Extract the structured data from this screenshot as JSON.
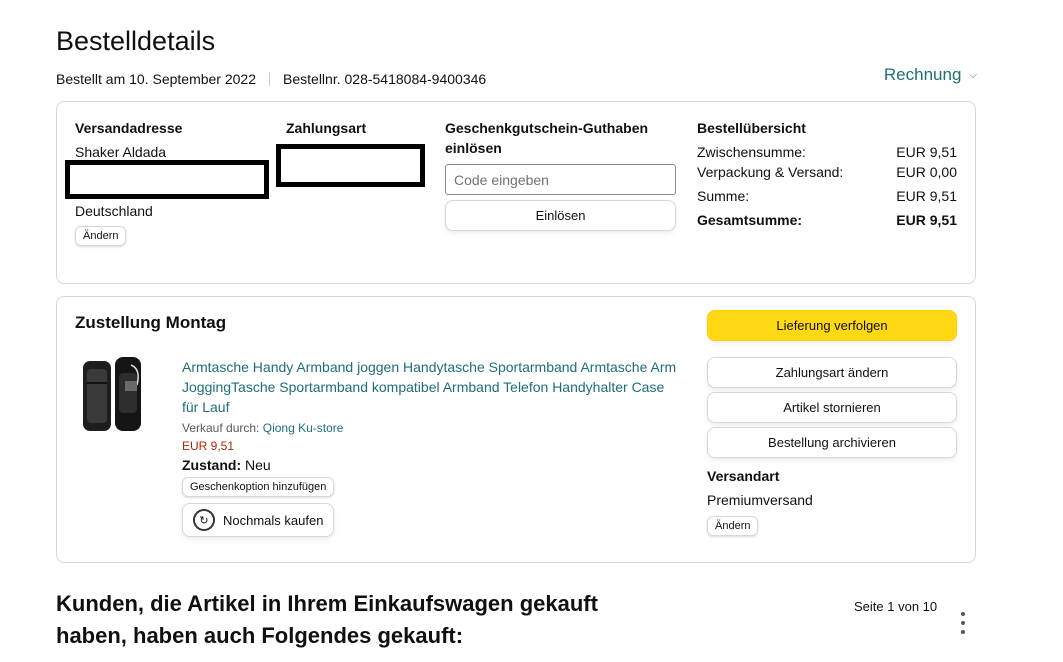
{
  "header": {
    "title": "Bestelldetails",
    "ordered_on": "Bestellt am 10. September 2022",
    "order_number": "Bestellnr. 028-5418084-9400346",
    "invoice_label": "Rechnung"
  },
  "address": {
    "title": "Versandadresse",
    "name": "Shaker Aldada",
    "country": "Deutschland",
    "change_label": "Ändern"
  },
  "payment": {
    "title": "Zahlungsart"
  },
  "giftcard": {
    "title": "Geschenkgutschein-Guthaben einlösen",
    "placeholder": "Code eingeben",
    "redeem_label": "Einlösen"
  },
  "summary": {
    "title": "Bestellübersicht",
    "rows": [
      {
        "label": "Zwischensumme:",
        "value": "EUR 9,51"
      },
      {
        "label": "Verpackung & Versand:",
        "value": "EUR 0,00"
      },
      {
        "label": "Summe:",
        "value": "EUR 9,51"
      }
    ],
    "total_label": "Gesamtsumme:",
    "total_value": "EUR 9,51"
  },
  "delivery": {
    "title": "Zustellung Montag",
    "product": {
      "title": "Armtasche Handy Armband joggen Handytasche Sportarmband Armtasche Arm JoggingTasche Sportarmband kompatibel Armband Telefon Handyhalter Case für Lauf",
      "seller_prefix": "Verkauf durch:",
      "seller_name": "Qiong Ku-store",
      "price": "EUR 9,51",
      "condition_label": "Zustand:",
      "condition_value": "Neu",
      "gift_label": "Geschenkoption hinzufügen",
      "buy_again_label": "Nochmals kaufen"
    },
    "actions": {
      "track": "Lieferung verfolgen",
      "change_payment": "Zahlungsart ändern",
      "cancel": "Artikel stornieren",
      "archive": "Bestellung archivieren"
    },
    "shipping": {
      "title": "Versandart",
      "value": "Premiumversand",
      "change_label": "Ändern"
    }
  },
  "recommendations": {
    "title": "Kunden, die Artikel in Ihrem Einkaufswagen gekauft haben, haben auch Folgendes gekauft:",
    "pager": "Seite 1 von 10"
  },
  "colors": {
    "link": "#1f6e78",
    "price": "#b12704",
    "primary_button": "#ffd814"
  }
}
